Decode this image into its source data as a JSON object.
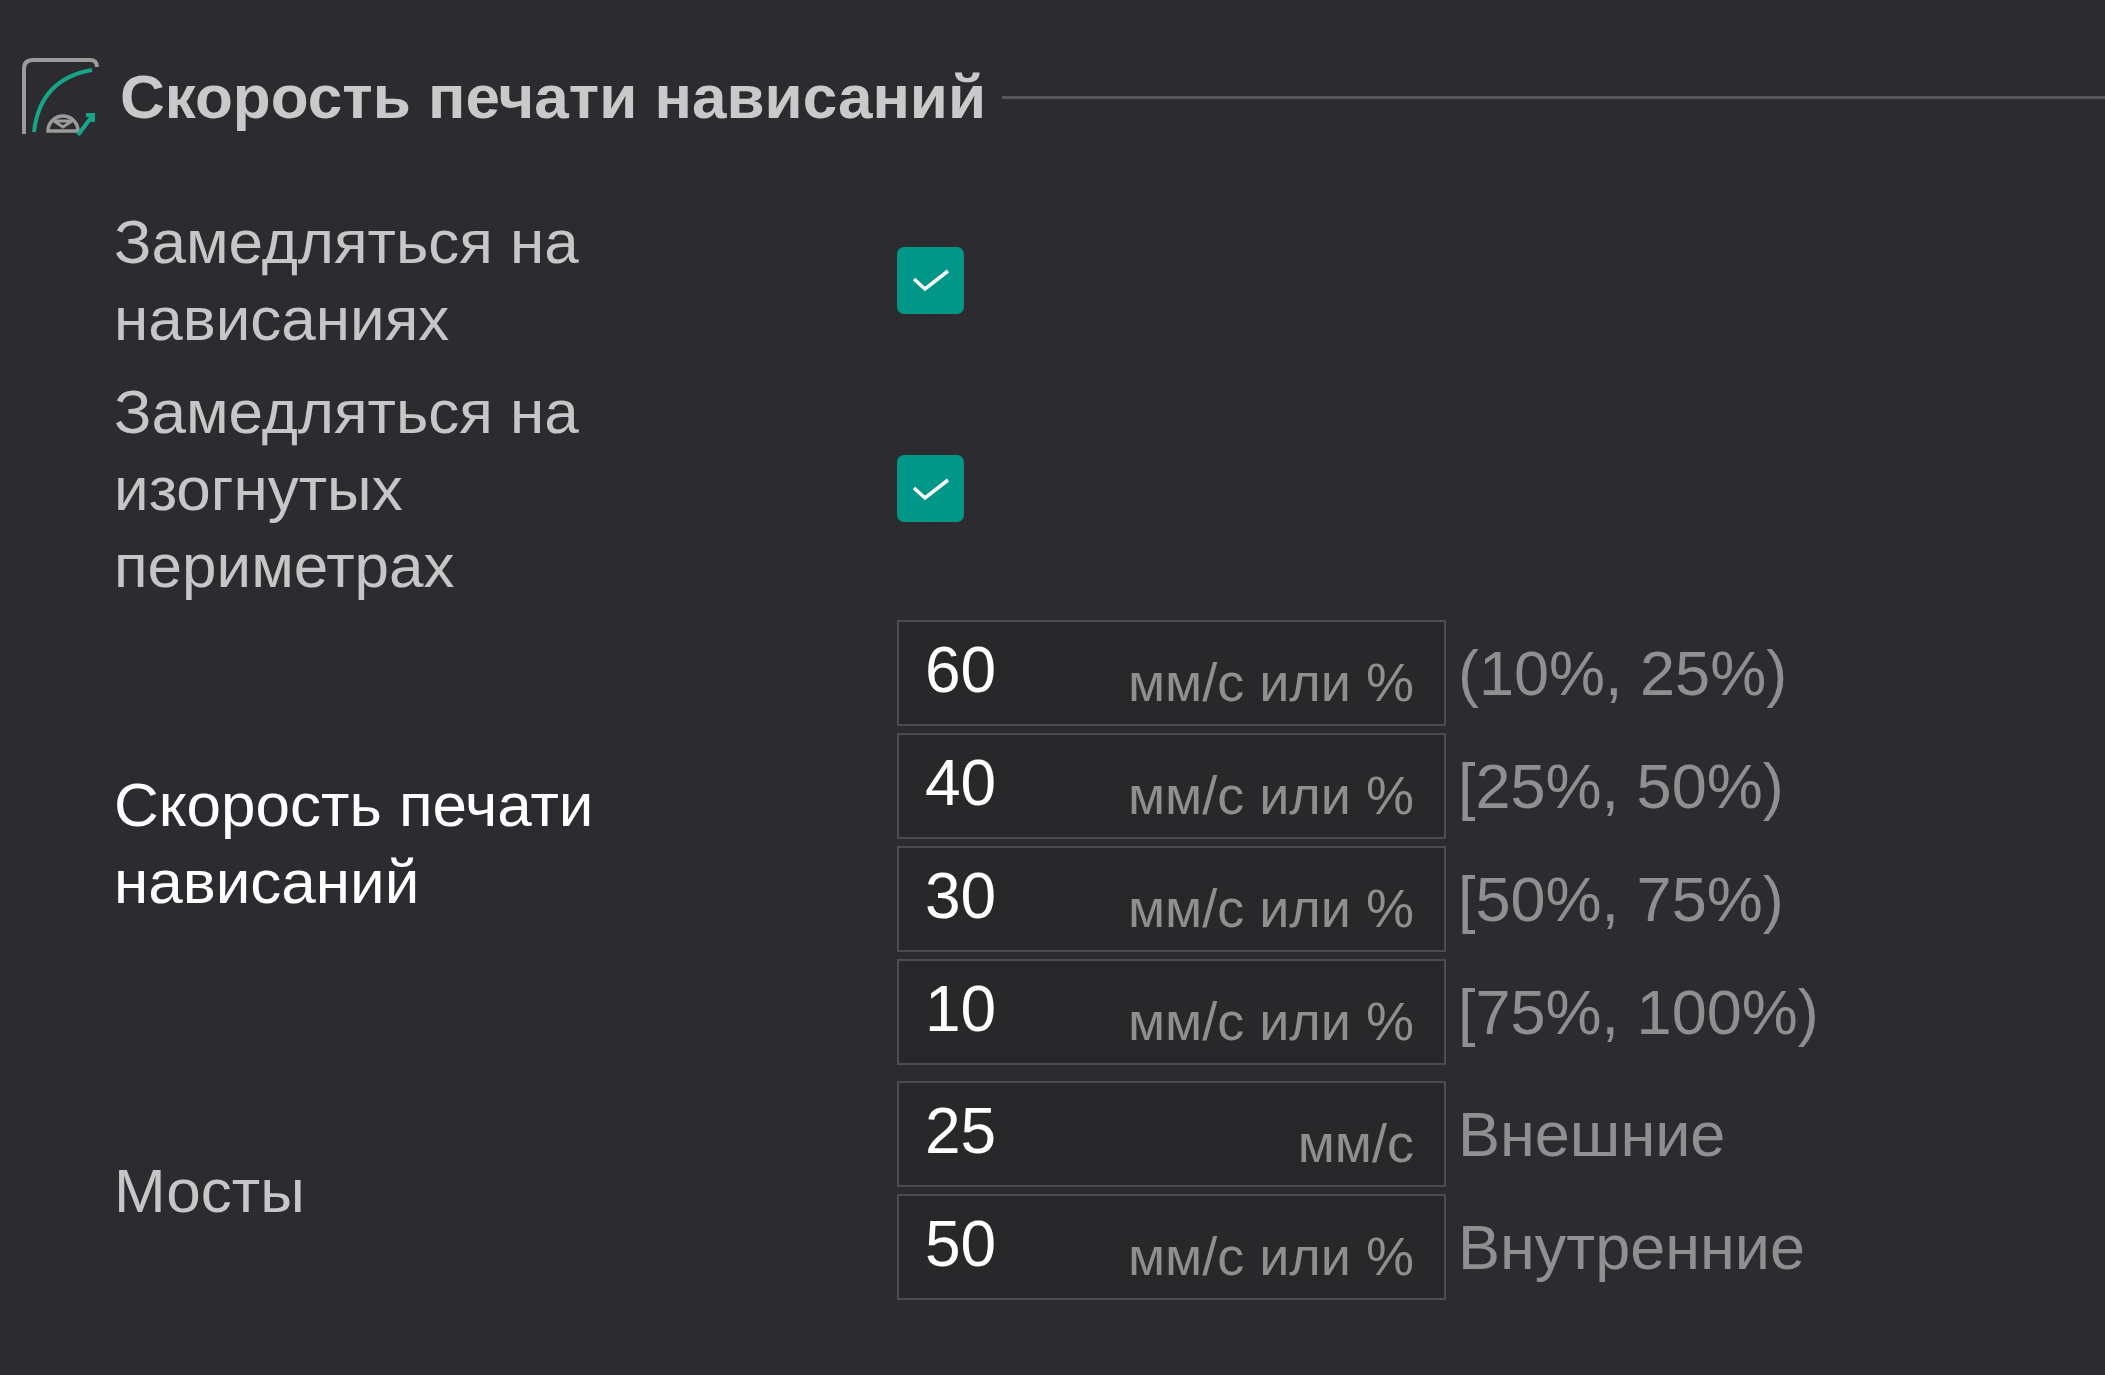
{
  "section": {
    "title": "Скорость печати нависаний"
  },
  "settings": [
    {
      "kind": "checkbox",
      "label": "Замедляться на нависаниях",
      "highlighted": false,
      "checked": true
    },
    {
      "kind": "checkbox",
      "label": "Замедляться на изогнутых периметрах",
      "highlighted": false,
      "checked": true
    },
    {
      "kind": "fields",
      "label": "Скорость печати нависаний",
      "highlighted": true,
      "fields": [
        {
          "value": "60",
          "unit": "мм/с или %",
          "note": "(10%, 25%)"
        },
        {
          "value": "40",
          "unit": "мм/с или %",
          "note": "[25%, 50%)"
        },
        {
          "value": "30",
          "unit": "мм/с или %",
          "note": "[50%, 75%)"
        },
        {
          "value": "10",
          "unit": "мм/с или %",
          "note": "[75%, 100%)"
        }
      ]
    },
    {
      "kind": "fields",
      "label": "Мосты",
      "highlighted": false,
      "fields": [
        {
          "value": "25",
          "unit": "мм/с",
          "note": "Внешние"
        },
        {
          "value": "50",
          "unit": "мм/с или %",
          "note": "Внутренние"
        }
      ]
    }
  ]
}
